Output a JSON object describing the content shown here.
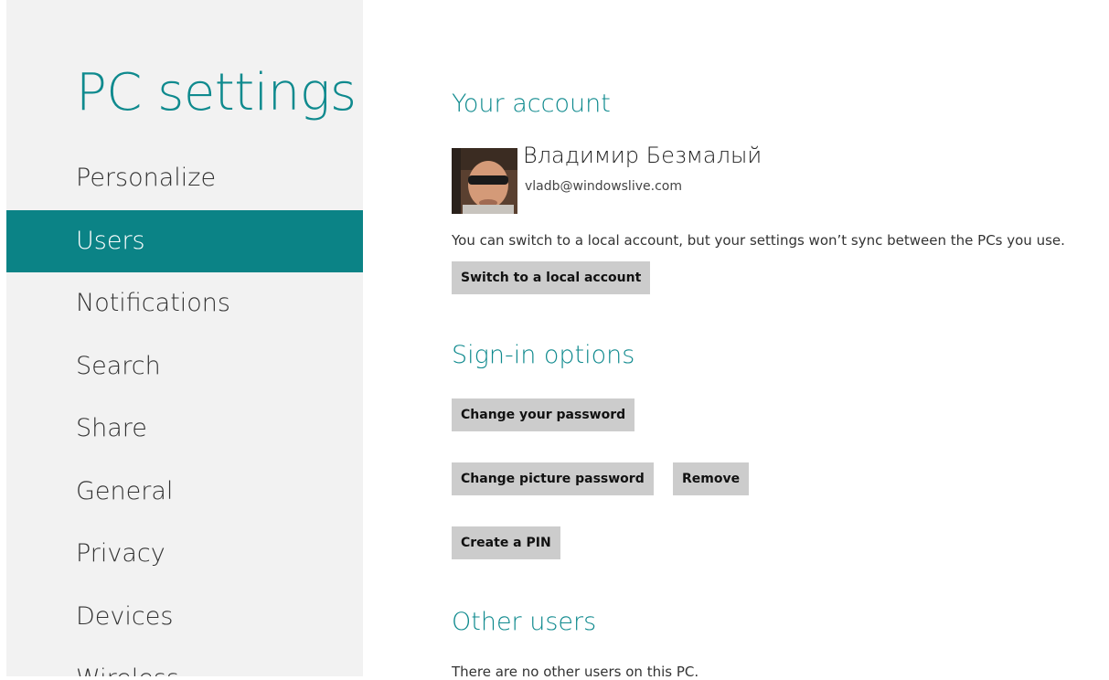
{
  "nav": {
    "title": "PC settings",
    "items": [
      {
        "label": "Personalize",
        "selected": false
      },
      {
        "label": "Users",
        "selected": true
      },
      {
        "label": "Notifications",
        "selected": false
      },
      {
        "label": "Search",
        "selected": false
      },
      {
        "label": "Share",
        "selected": false
      },
      {
        "label": "General",
        "selected": false
      },
      {
        "label": "Privacy",
        "selected": false
      },
      {
        "label": "Devices",
        "selected": false
      },
      {
        "label": "Wireless",
        "selected": false
      }
    ]
  },
  "account": {
    "heading": "Your account",
    "name": "Владимир Безмалый",
    "email": "vladb@windowslive.com",
    "info": "You can switch to a local account, but your settings won’t sync between the PCs you use.",
    "switch_button": "Switch to a local account"
  },
  "signin": {
    "heading": "Sign-in options",
    "change_password_button": "Change your password",
    "change_picture_password_button": "Change picture password",
    "remove_button": "Remove",
    "create_pin_button": "Create a PIN"
  },
  "other_users": {
    "heading": "Other users",
    "info": "There are no other users on this PC."
  },
  "colors": {
    "accent": "#0f8a8e",
    "selected_bg": "#0b8386",
    "nav_bg": "#f2f2f2",
    "button_bg": "#cccccc"
  }
}
